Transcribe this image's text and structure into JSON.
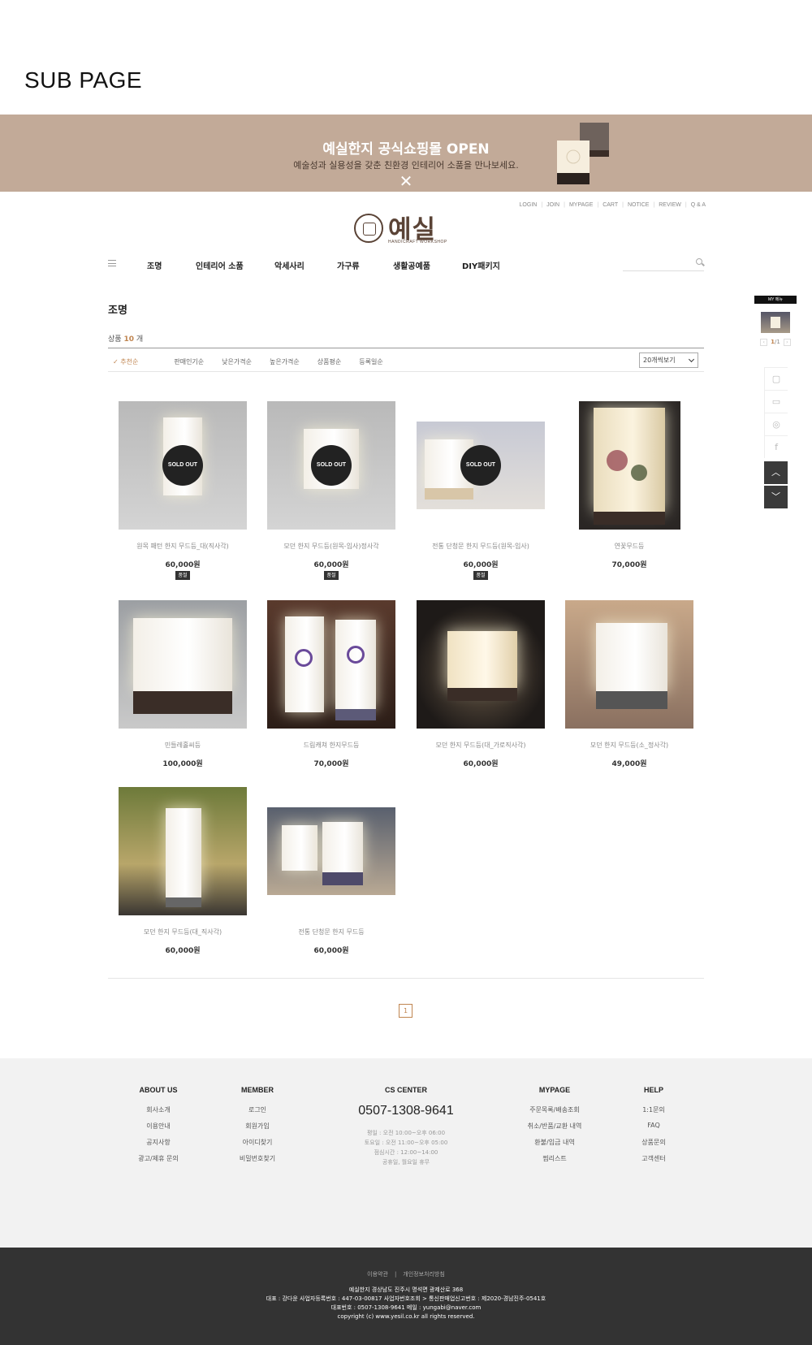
{
  "page": {
    "sub_title": "SUB PAGE"
  },
  "banner": {
    "title": "예실한지 공식쇼핑몰 OPEN",
    "subtitle": "예술성과 실용성을 갖춘 친환경 인테리어 소품을 만나보세요.",
    "close_label": "✕"
  },
  "util_menu": [
    "LOGIN",
    "JOIN",
    "MYPAGE",
    "CART",
    "NOTICE",
    "REVIEW",
    "Q & A"
  ],
  "logo": {
    "text": "예실",
    "sub": "HANDICRAFT WORKSHOP"
  },
  "nav": {
    "items": [
      "조명",
      "인테리어 소품",
      "악세사리",
      "가구류",
      "생활공예품",
      "DIY패키지"
    ],
    "search_placeholder": ""
  },
  "category": {
    "title": "조명",
    "count_label": "상품",
    "count": "10",
    "count_unit": "개",
    "sort_options": [
      "추천순",
      "판매인기순",
      "낮은가격순",
      "높은가격순",
      "상품평순",
      "등록일순"
    ],
    "view_select": "20개씩보기"
  },
  "products": [
    {
      "name": "원목 패턴 한지 무드등_대(직사각)",
      "price": "60,000원",
      "sold_out": true,
      "badge": "품절"
    },
    {
      "name": "모던 한지 무드등(원목-입사)정사각",
      "price": "60,000원",
      "sold_out": true,
      "badge": "품절"
    },
    {
      "name": "전통 단청문 한지 무드등(원목-입사)",
      "price": "60,000원",
      "sold_out": true,
      "badge": "품절"
    },
    {
      "name": "연꽃무드등",
      "price": "70,000원",
      "sold_out": false
    },
    {
      "name": "민들레홀씨등",
      "price": "100,000원",
      "sold_out": false
    },
    {
      "name": "드림캐쳐 한지무드등",
      "price": "70,000원",
      "sold_out": false
    },
    {
      "name": "모던 한지 무드등(대_가로직사각)",
      "price": "60,000원",
      "sold_out": false
    },
    {
      "name": "모던 한지 무드등(소_정사각)",
      "price": "49,000원",
      "sold_out": false
    },
    {
      "name": "모던 한지 무드등(대_직사각)",
      "price": "60,000원",
      "sold_out": false
    },
    {
      "name": "전통 단청문 한지 무드등",
      "price": "60,000원",
      "sold_out": false
    }
  ],
  "sold_out_label": "SOLD OUT",
  "pagination": {
    "current": "1"
  },
  "quick_menu": {
    "title": "MY 메뉴",
    "page_current": "1",
    "page_total": "1"
  },
  "footer": {
    "about": {
      "title": "ABOUT US",
      "links": [
        "회사소개",
        "이용안내",
        "공지사항",
        "광고/제휴 문의"
      ]
    },
    "member": {
      "title": "MEMBER",
      "links": [
        "로그인",
        "회원가입",
        "아이디찾기",
        "비밀번호찾기"
      ]
    },
    "cs": {
      "title": "CS CENTER",
      "phone": "0507-1308-9641",
      "hours": [
        "평일 : 오전 10:00~오후 06:00",
        "토요일 : 오전 11:00~오후 05:00",
        "점심시간 : 12:00~14:00",
        "공휴일, 월요일 휴무"
      ]
    },
    "mypage": {
      "title": "MYPAGE",
      "links": [
        "주문목록/배송조회",
        "취소/반품/교환 내역",
        "환불/입금 내역",
        "찜리스트"
      ]
    },
    "help": {
      "title": "HELP",
      "links": [
        "1:1문의",
        "FAQ",
        "상품문의",
        "고객센터"
      ]
    },
    "bottom_links": [
      "이용약관",
      "개인정보처리방침"
    ],
    "info": [
      "예실한지 경상남도 진주시 명석면 광제산로 368",
      "대표 : 강다윤    사업자등록번호 : 447-03-00817 사업자번호조회 >    통신판매업신고번호 : 제2020-경남진주-0541호",
      "대표번호 : 0507-1308-9641    메일 : yungabi@naver.com",
      "copyright (c) www.yesil.co.kr all rights reserved."
    ]
  },
  "colors": {
    "banner": "#c2aa98",
    "accent": "#c08550",
    "footer_dark": "#333333"
  }
}
